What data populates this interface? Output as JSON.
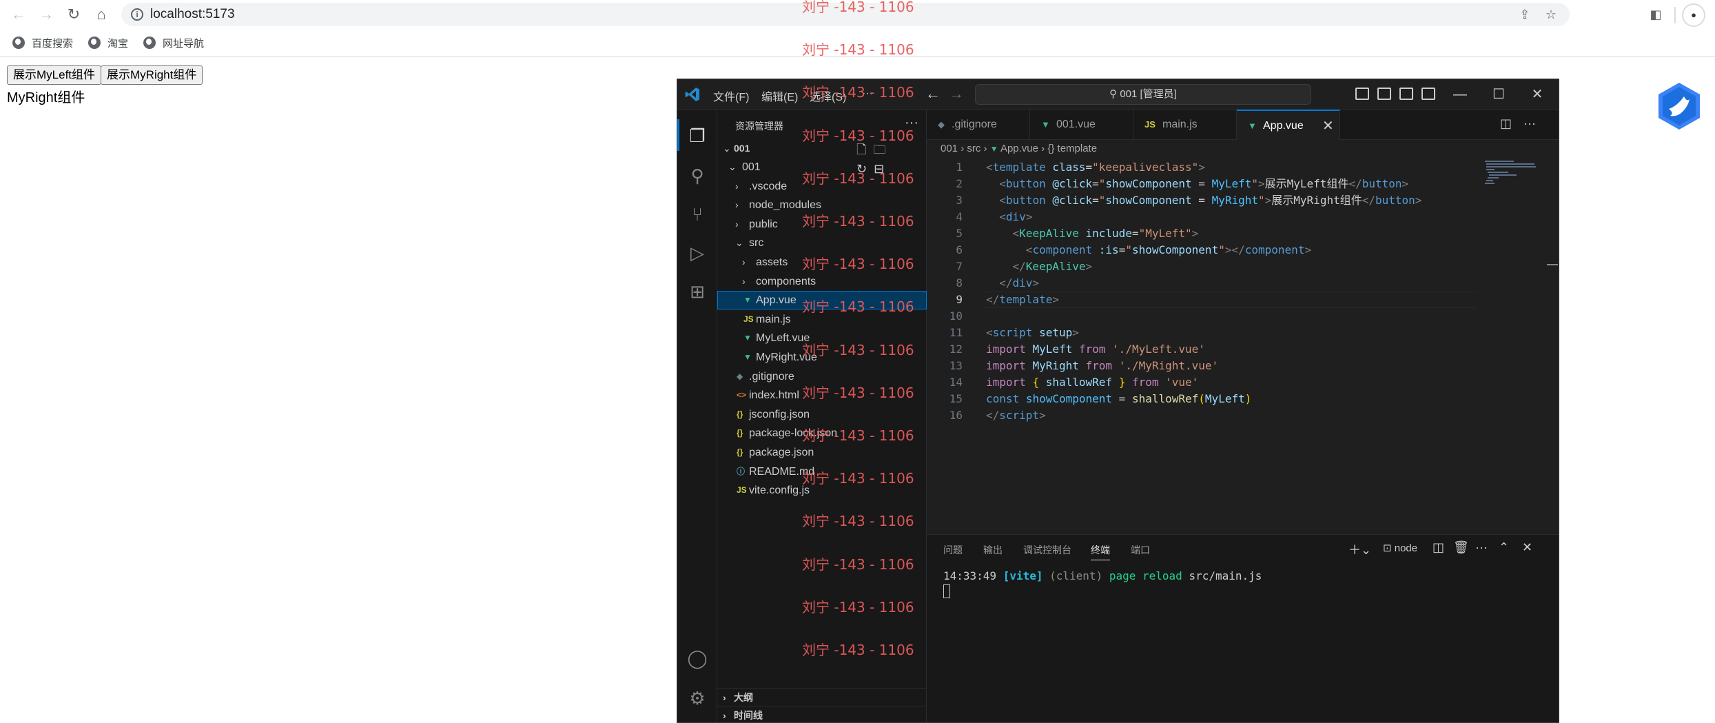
{
  "browser": {
    "url": "localhost:5173",
    "bookmarks": [
      "百度搜索",
      "淘宝",
      "网址导航"
    ]
  },
  "page": {
    "buttons": [
      "展示MyLeft组件",
      "展示MyRight组件"
    ],
    "text": "MyRight组件"
  },
  "vscode": {
    "menus": [
      "文件(F)",
      "编辑(E)",
      "选择(S)",
      "···"
    ],
    "search": "001 [管理员]",
    "explorer_title": "资源管理器",
    "root": "001",
    "tree": [
      {
        "label": "001",
        "kind": "folder-open",
        "depth": 0
      },
      {
        "label": ".vscode",
        "kind": "folder",
        "depth": 1
      },
      {
        "label": "node_modules",
        "kind": "folder",
        "depth": 1
      },
      {
        "label": "public",
        "kind": "folder",
        "depth": 1
      },
      {
        "label": "src",
        "kind": "folder-open",
        "depth": 1
      },
      {
        "label": "assets",
        "kind": "folder",
        "depth": 2
      },
      {
        "label": "components",
        "kind": "folder",
        "depth": 2
      },
      {
        "label": "App.vue",
        "kind": "vue",
        "depth": 2
      },
      {
        "label": "main.js",
        "kind": "js",
        "depth": 2
      },
      {
        "label": "MyLeft.vue",
        "kind": "vue",
        "depth": 2
      },
      {
        "label": "MyRight.vue",
        "kind": "vue",
        "depth": 2
      },
      {
        "label": ".gitignore",
        "kind": "git",
        "depth": 1
      },
      {
        "label": "index.html",
        "kind": "html",
        "depth": 1
      },
      {
        "label": "jsconfig.json",
        "kind": "json",
        "depth": 1
      },
      {
        "label": "package-lock.json",
        "kind": "json",
        "depth": 1
      },
      {
        "label": "package.json",
        "kind": "json",
        "depth": 1
      },
      {
        "label": "README.md",
        "kind": "info",
        "depth": 1
      },
      {
        "label": "vite.config.js",
        "kind": "js",
        "depth": 1
      }
    ],
    "outline": "大纲",
    "timeline": "时间线",
    "tabs": [
      ".gitignore",
      "001.vue",
      "main.js",
      "App.vue"
    ],
    "breadcrumb": [
      "001",
      "src",
      "App.vue",
      "{} template"
    ],
    "code": [
      {
        "n": "1",
        "tokens": [
          [
            "t",
            "<"
          ],
          [
            "tg",
            "template"
          ],
          [
            "tx",
            " "
          ],
          [
            "at",
            "class"
          ],
          [
            "tx",
            "="
          ],
          [
            "st",
            "\"keepaliveclass\""
          ],
          [
            "t",
            ">"
          ]
        ]
      },
      {
        "n": "2",
        "tokens": [
          [
            "tx",
            "  "
          ],
          [
            "t",
            "<"
          ],
          [
            "tg",
            "button"
          ],
          [
            "tx",
            " "
          ],
          [
            "at",
            "@click"
          ],
          [
            "tx",
            "="
          ],
          [
            "st",
            "\""
          ],
          [
            "vr",
            "showComponent"
          ],
          [
            "tx",
            " = "
          ],
          [
            "bl",
            "MyLeft"
          ],
          [
            "st",
            "\""
          ],
          [
            "t",
            ">"
          ],
          [
            "tx",
            "展示MyLeft组件"
          ],
          [
            "t",
            "</"
          ],
          [
            "tg",
            "button"
          ],
          [
            "t",
            ">"
          ]
        ]
      },
      {
        "n": "3",
        "tokens": [
          [
            "tx",
            "  "
          ],
          [
            "t",
            "<"
          ],
          [
            "tg",
            "button"
          ],
          [
            "tx",
            " "
          ],
          [
            "at",
            "@click"
          ],
          [
            "tx",
            "="
          ],
          [
            "st",
            "\""
          ],
          [
            "vr",
            "showComponent"
          ],
          [
            "tx",
            " = "
          ],
          [
            "bl",
            "MyRight"
          ],
          [
            "st",
            "\""
          ],
          [
            "t",
            ">"
          ],
          [
            "tx",
            "展示MyRight组件"
          ],
          [
            "t",
            "</"
          ],
          [
            "tg",
            "button"
          ],
          [
            "t",
            ">"
          ]
        ]
      },
      {
        "n": "4",
        "tokens": [
          [
            "tx",
            "  "
          ],
          [
            "t",
            "<"
          ],
          [
            "tg",
            "div"
          ],
          [
            "t",
            ">"
          ]
        ]
      },
      {
        "n": "5",
        "tokens": [
          [
            "tx",
            "    "
          ],
          [
            "t",
            "<"
          ],
          [
            "cm",
            "KeepAlive"
          ],
          [
            "tx",
            " "
          ],
          [
            "at",
            "include"
          ],
          [
            "tx",
            "="
          ],
          [
            "st",
            "\"MyLeft\""
          ],
          [
            "t",
            ">"
          ]
        ]
      },
      {
        "n": "6",
        "tokens": [
          [
            "tx",
            "      "
          ],
          [
            "t",
            "<"
          ],
          [
            "tg",
            "component"
          ],
          [
            "tx",
            " "
          ],
          [
            "at",
            ":is"
          ],
          [
            "tx",
            "="
          ],
          [
            "st",
            "\""
          ],
          [
            "vr",
            "showComponent"
          ],
          [
            "st",
            "\""
          ],
          [
            "t",
            "></"
          ],
          [
            "tg",
            "component"
          ],
          [
            "t",
            ">"
          ]
        ]
      },
      {
        "n": "7",
        "tokens": [
          [
            "tx",
            "    "
          ],
          [
            "t",
            "</"
          ],
          [
            "cm",
            "KeepAlive"
          ],
          [
            "t",
            ">"
          ]
        ]
      },
      {
        "n": "8",
        "tokens": [
          [
            "tx",
            "  "
          ],
          [
            "t",
            "</"
          ],
          [
            "tg",
            "div"
          ],
          [
            "t",
            ">"
          ]
        ]
      },
      {
        "n": "9",
        "tokens": [
          [
            "t",
            "</"
          ],
          [
            "tg",
            "template"
          ],
          [
            "t",
            ">"
          ]
        ]
      },
      {
        "n": "10",
        "tokens": []
      },
      {
        "n": "11",
        "tokens": [
          [
            "t",
            "<"
          ],
          [
            "tg",
            "script"
          ],
          [
            "tx",
            " "
          ],
          [
            "at",
            "setup"
          ],
          [
            "t",
            ">"
          ]
        ]
      },
      {
        "n": "12",
        "tokens": [
          [
            "kw",
            "import"
          ],
          [
            "tx",
            " "
          ],
          [
            "vr",
            "MyLeft"
          ],
          [
            "tx",
            " "
          ],
          [
            "kw",
            "from"
          ],
          [
            "tx",
            " "
          ],
          [
            "st",
            "'./MyLeft.vue'"
          ]
        ]
      },
      {
        "n": "13",
        "tokens": [
          [
            "kw",
            "import"
          ],
          [
            "tx",
            " "
          ],
          [
            "vr",
            "MyRight"
          ],
          [
            "tx",
            " "
          ],
          [
            "kw",
            "from"
          ],
          [
            "tx",
            " "
          ],
          [
            "st",
            "'./MyRight.vue'"
          ]
        ]
      },
      {
        "n": "14",
        "tokens": [
          [
            "kw",
            "import"
          ],
          [
            "tx",
            " "
          ],
          [
            "br",
            "{"
          ],
          [
            "tx",
            " "
          ],
          [
            "vr",
            "shallowRef"
          ],
          [
            "tx",
            " "
          ],
          [
            "br",
            "}"
          ],
          [
            "tx",
            " "
          ],
          [
            "kw",
            "from"
          ],
          [
            "tx",
            " "
          ],
          [
            "st",
            "'vue'"
          ]
        ]
      },
      {
        "n": "15",
        "tokens": [
          [
            "tg",
            "const"
          ],
          [
            "tx",
            " "
          ],
          [
            "bl",
            "showComponent"
          ],
          [
            "tx",
            " = "
          ],
          [
            "fn",
            "shallowRef"
          ],
          [
            "br",
            "("
          ],
          [
            "vr",
            "MyLeft"
          ],
          [
            "br",
            ")"
          ]
        ]
      },
      {
        "n": "16",
        "tokens": [
          [
            "t",
            "</"
          ],
          [
            "tg",
            "script"
          ],
          [
            "t",
            ">"
          ]
        ]
      }
    ],
    "panel_tabs": [
      "问题",
      "输出",
      "调试控制台",
      "终端",
      "端口"
    ],
    "terminal_name": "node",
    "terminal": {
      "time": "14:33:49",
      "tag": "[vite]",
      "client": "(client)",
      "msg": "page reload",
      "file": "src/main.js"
    }
  },
  "watermark": "刘宁 -143 - 1106"
}
